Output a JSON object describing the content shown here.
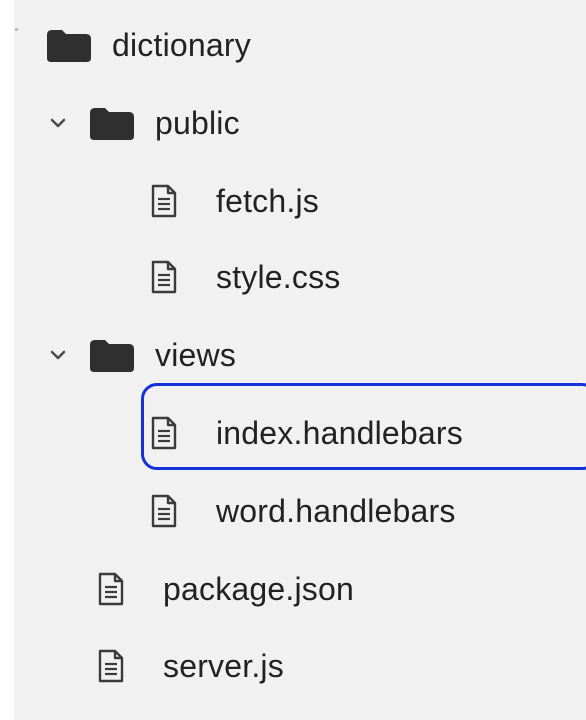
{
  "tree": {
    "root": {
      "label": "dictionary",
      "icon": "folder-icon",
      "items": [
        {
          "type": "folder",
          "label": "public",
          "expanded": true,
          "chevron": "chevron-down-icon",
          "icon": "folder-icon",
          "items": [
            {
              "type": "file",
              "label": "fetch.js",
              "icon": "file-icon"
            },
            {
              "type": "file",
              "label": "style.css",
              "icon": "file-icon"
            }
          ]
        },
        {
          "type": "folder",
          "label": "views",
          "expanded": true,
          "chevron": "chevron-down-icon",
          "icon": "folder-icon",
          "items": [
            {
              "type": "file",
              "label": "index.handlebars",
              "icon": "file-icon",
              "selected": true
            },
            {
              "type": "file",
              "label": "word.handlebars",
              "icon": "file-icon"
            }
          ]
        },
        {
          "type": "file",
          "label": "package.json",
          "icon": "file-icon"
        },
        {
          "type": "file",
          "label": "server.js",
          "icon": "file-icon"
        }
      ]
    }
  },
  "colors": {
    "panel_background": "#f1f1f1",
    "text": "#222222",
    "folder_icon": "#2f2f2f",
    "file_icon_stroke": "#3b3b3b",
    "chevron": "#4a4a4a",
    "selection_border": "#1432d8"
  }
}
